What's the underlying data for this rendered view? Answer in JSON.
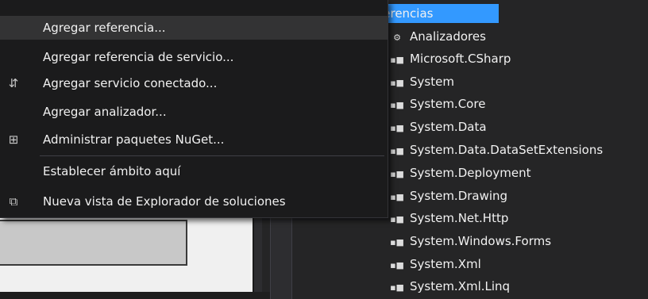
{
  "context_menu": {
    "items": [
      {
        "label": "Agregar referencia...",
        "icon": ""
      },
      {
        "label": "Agregar referencia de servicio...",
        "icon": ""
      },
      {
        "label": "Agregar servicio conectado...",
        "icon": "connected-service-icon"
      },
      {
        "label": "Agregar analizador...",
        "icon": ""
      },
      {
        "label": "Administrar paquetes NuGet...",
        "icon": "nuget-icon"
      },
      {
        "label": "Establecer ámbito aquí",
        "icon": ""
      },
      {
        "label": "Nueva vista de Explorador de soluciones",
        "icon": "new-view-icon"
      }
    ]
  },
  "solution_explorer": {
    "root": "Referencias",
    "analyzers": "Analizadores",
    "references": [
      "Microsoft.CSharp",
      "System",
      "System.Core",
      "System.Data",
      "System.Data.DataSetExtensions",
      "System.Deployment",
      "System.Drawing",
      "System.Net.Http",
      "System.Windows.Forms",
      "System.Xml",
      "System.Xml.Linq"
    ]
  },
  "colors": {
    "menu_bg": "#1b1b1c",
    "selection": "#3399ff",
    "text": "#f1f1f1"
  }
}
